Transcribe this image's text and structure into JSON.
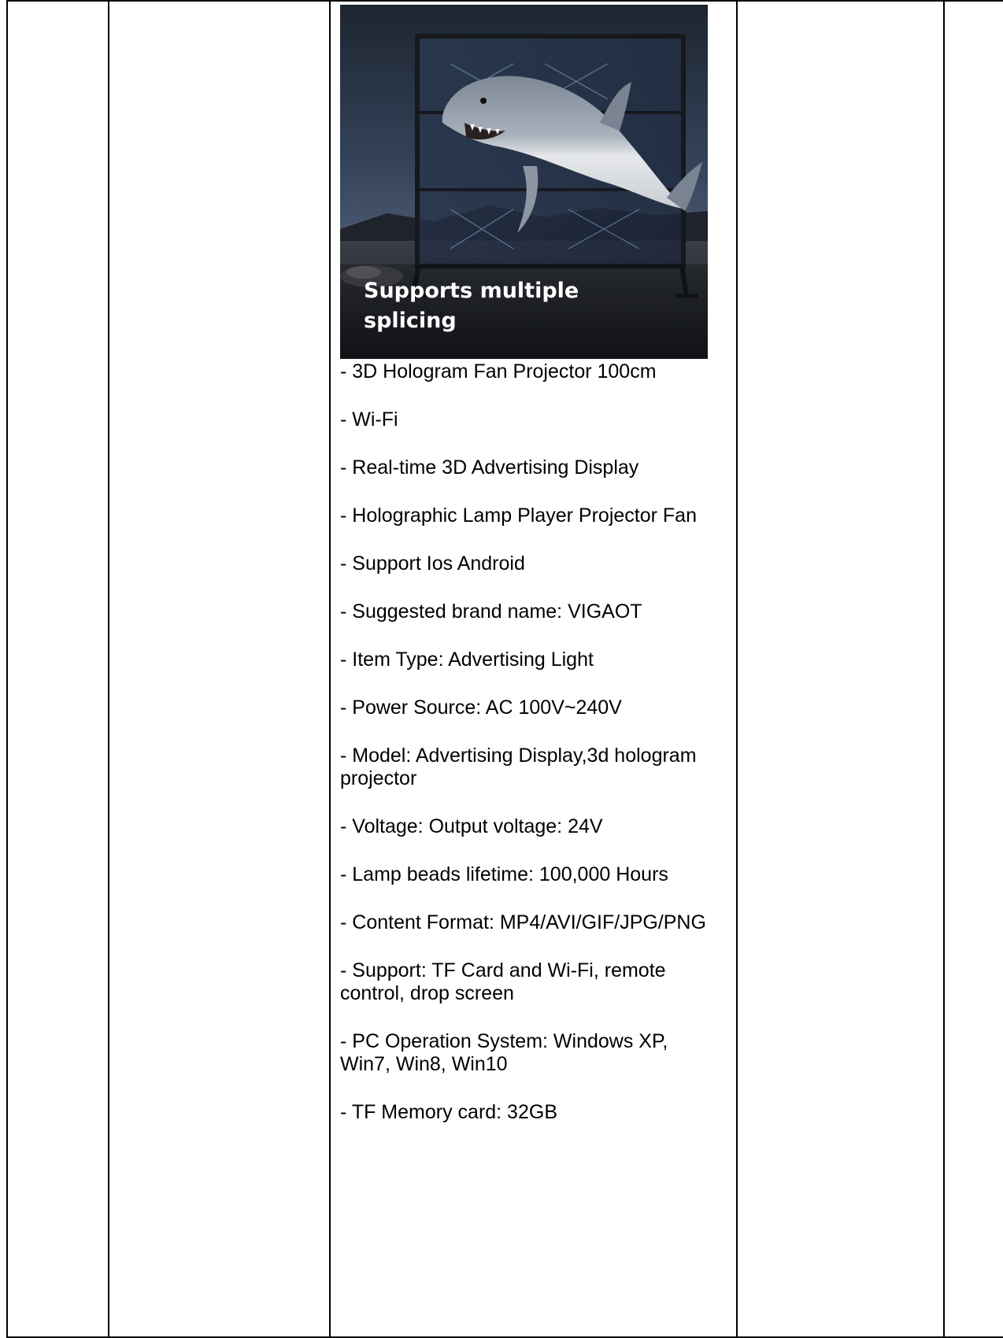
{
  "image_caption": {
    "line1": "Supports multiple",
    "line2": "splicing"
  },
  "specs": [
    "- 3D Hologram Fan Projector 100cm",
    "- Wi-Fi",
    "- Real-time 3D Advertising Display",
    "- Holographic Lamp Player Projector Fan",
    "- Support Ios Android",
    "- Suggested brand name: VIGAOT",
    "- Item Type: Advertising Light",
    "- Power Source: AC 100V~240V",
    "- Model: Advertising Display,3d hologram projector",
    "- Voltage: Output voltage: 24V",
    "- Lamp beads lifetime: 100,000 Hours",
    "- Content Format: MP4/AVI/GIF/JPG/PNG",
    "- Support: TF Card and Wi-Fi, remote control, drop screen",
    "- PC Operation System: Windows XP, Win7, Win8, Win10",
    "- TF Memory card: 32GB"
  ]
}
